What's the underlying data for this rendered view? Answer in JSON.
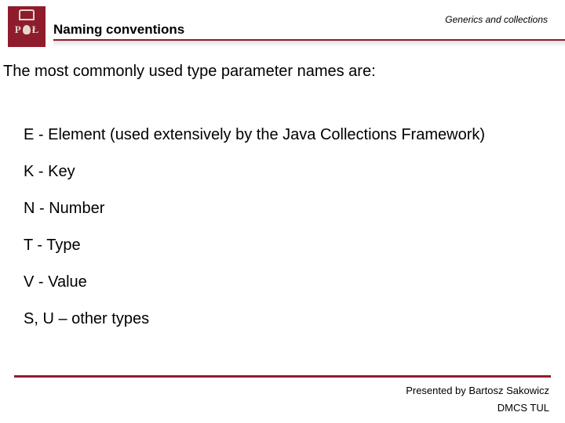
{
  "header": {
    "slide_title": "Naming conventions",
    "topic": "Generics and collections",
    "logo_letters": {
      "left": "P",
      "right": "Ł"
    }
  },
  "content": {
    "lead": "The most commonly used type parameter names are:",
    "items": [
      "E - Element (used extensively by the Java Collections Framework)",
      "K - Key",
      "N - Number",
      "T - Type",
      "V - Value",
      "S, U – other types"
    ]
  },
  "footer": {
    "presenter": "Presented by Bartosz Sakowicz",
    "affiliation": "DMCS TUL"
  }
}
